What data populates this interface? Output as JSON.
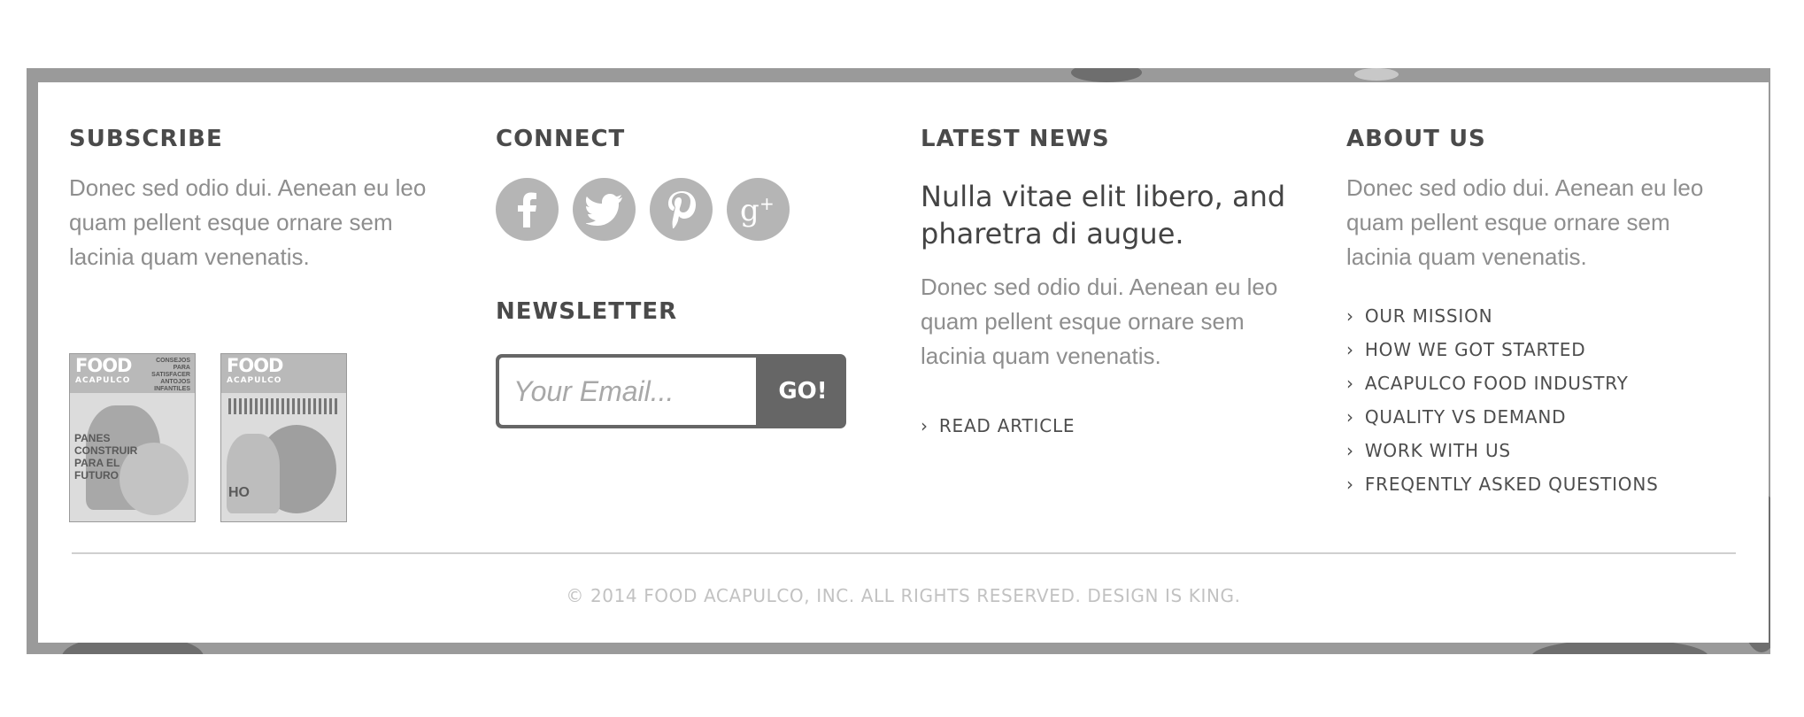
{
  "subscribe": {
    "heading": "SUBSCRIBE",
    "text": "Donec sed odio dui. Aenean eu leo quam pellent esque ornare sem lacinia quam venenatis.",
    "magazines": [
      {
        "logo": "FOOD",
        "sub": "ACAPULCO",
        "tag": "CONSEJOS PARA SATISFACER ANTOJOS INFANTILES",
        "cover": "PANES CONSTRUIR PARA EL FUTURO"
      },
      {
        "logo": "FOOD",
        "sub": "ACAPULCO",
        "tag": "",
        "cover": "HO"
      }
    ]
  },
  "connect": {
    "heading": "CONNECT",
    "social": [
      {
        "name": "facebook-icon"
      },
      {
        "name": "twitter-icon"
      },
      {
        "name": "pinterest-icon"
      },
      {
        "name": "google-plus-icon"
      }
    ]
  },
  "newsletter": {
    "heading": "NEWSLETTER",
    "placeholder": "Your Email...",
    "button": "GO!"
  },
  "news": {
    "heading": "LATEST NEWS",
    "title": "Nulla vitae elit libero, and pharetra di augue.",
    "text": "Donec sed odio dui. Aenean eu leo quam pellent esque ornare sem lacinia quam venenatis.",
    "read_more": "READ ARTICLE"
  },
  "about": {
    "heading": "ABOUT US",
    "text": "Donec sed odio dui. Aenean eu leo quam pellent esque ornare sem lacinia quam venenatis.",
    "links": [
      "OUR MISSION",
      "HOW WE GOT STARTED",
      "ACAPULCO FOOD INDUSTRY",
      "QUALITY VS DEMAND",
      "WORK WITH US",
      "FREQENTLY ASKED QUESTIONS"
    ]
  },
  "footer": {
    "copyright": "© 2014 FOOD ACAPULCO, INC. ALL RIGHTS RESERVED. DESIGN IS KING."
  }
}
